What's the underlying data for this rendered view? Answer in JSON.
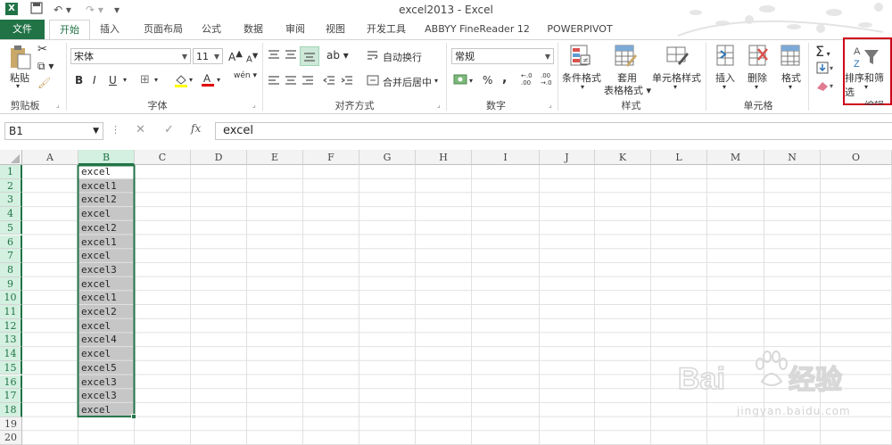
{
  "window": {
    "title": "excel2013 - Excel"
  },
  "tabs": [
    "文件",
    "开始",
    "插入",
    "页面布局",
    "公式",
    "数据",
    "审阅",
    "视图",
    "开发工具",
    "ABBYY FineReader 12",
    "POWERPIVOT"
  ],
  "ribbon": {
    "clipboard": {
      "paste": "粘贴",
      "label": "剪贴板"
    },
    "font": {
      "name": "宋体",
      "size": "11",
      "bold": "B",
      "italic": "I",
      "underline": "U",
      "grow": "A",
      "shrink": "A",
      "wen": "wén",
      "label": "字体"
    },
    "alignment": {
      "wrap": "自动换行",
      "merge": "合并后居中",
      "label": "对齐方式"
    },
    "number": {
      "format": "常规",
      "percent": "%",
      "comma": ",",
      "inc": "←.0 .00",
      "dec": ".00 →.0",
      "label": "数字"
    },
    "styles": {
      "conditional": "条件格式",
      "table_line1": "套用",
      "table_line2": "表格格式",
      "cell_styles": "单元格样式",
      "label": "样式"
    },
    "cells": {
      "insert": "插入",
      "delete": "删除",
      "format": "格式",
      "label": "单元格"
    },
    "editing": {
      "sigma": "Σ",
      "sort_filter": "排序和筛选",
      "label": "编辑"
    }
  },
  "formula_bar": {
    "name_box": "B1",
    "fx": "fx",
    "value": "excel"
  },
  "columns": [
    "A",
    "B",
    "C",
    "D",
    "E",
    "F",
    "G",
    "H",
    "I",
    "J",
    "K",
    "L",
    "M",
    "N",
    "O"
  ],
  "rows": [
    "1",
    "2",
    "3",
    "4",
    "5",
    "6",
    "7",
    "8",
    "9",
    "10",
    "11",
    "12",
    "13",
    "14",
    "15",
    "16",
    "17",
    "18",
    "19",
    "20"
  ],
  "column_b": [
    "excel",
    "excel1",
    "excel2",
    "excel",
    "excel2",
    "excel1",
    "excel",
    "excel3",
    "excel",
    "excel1",
    "excel2",
    "excel",
    "excel4",
    "excel",
    "excel5",
    "excel3",
    "excel3",
    "excel"
  ],
  "watermark": {
    "brand": "Baidu经验",
    "url": "jingyan.baidu.com"
  },
  "colors": {
    "excel_green": "#217346",
    "selection_fill": "#c6c6c6",
    "highlight_box": "#d0021b"
  }
}
